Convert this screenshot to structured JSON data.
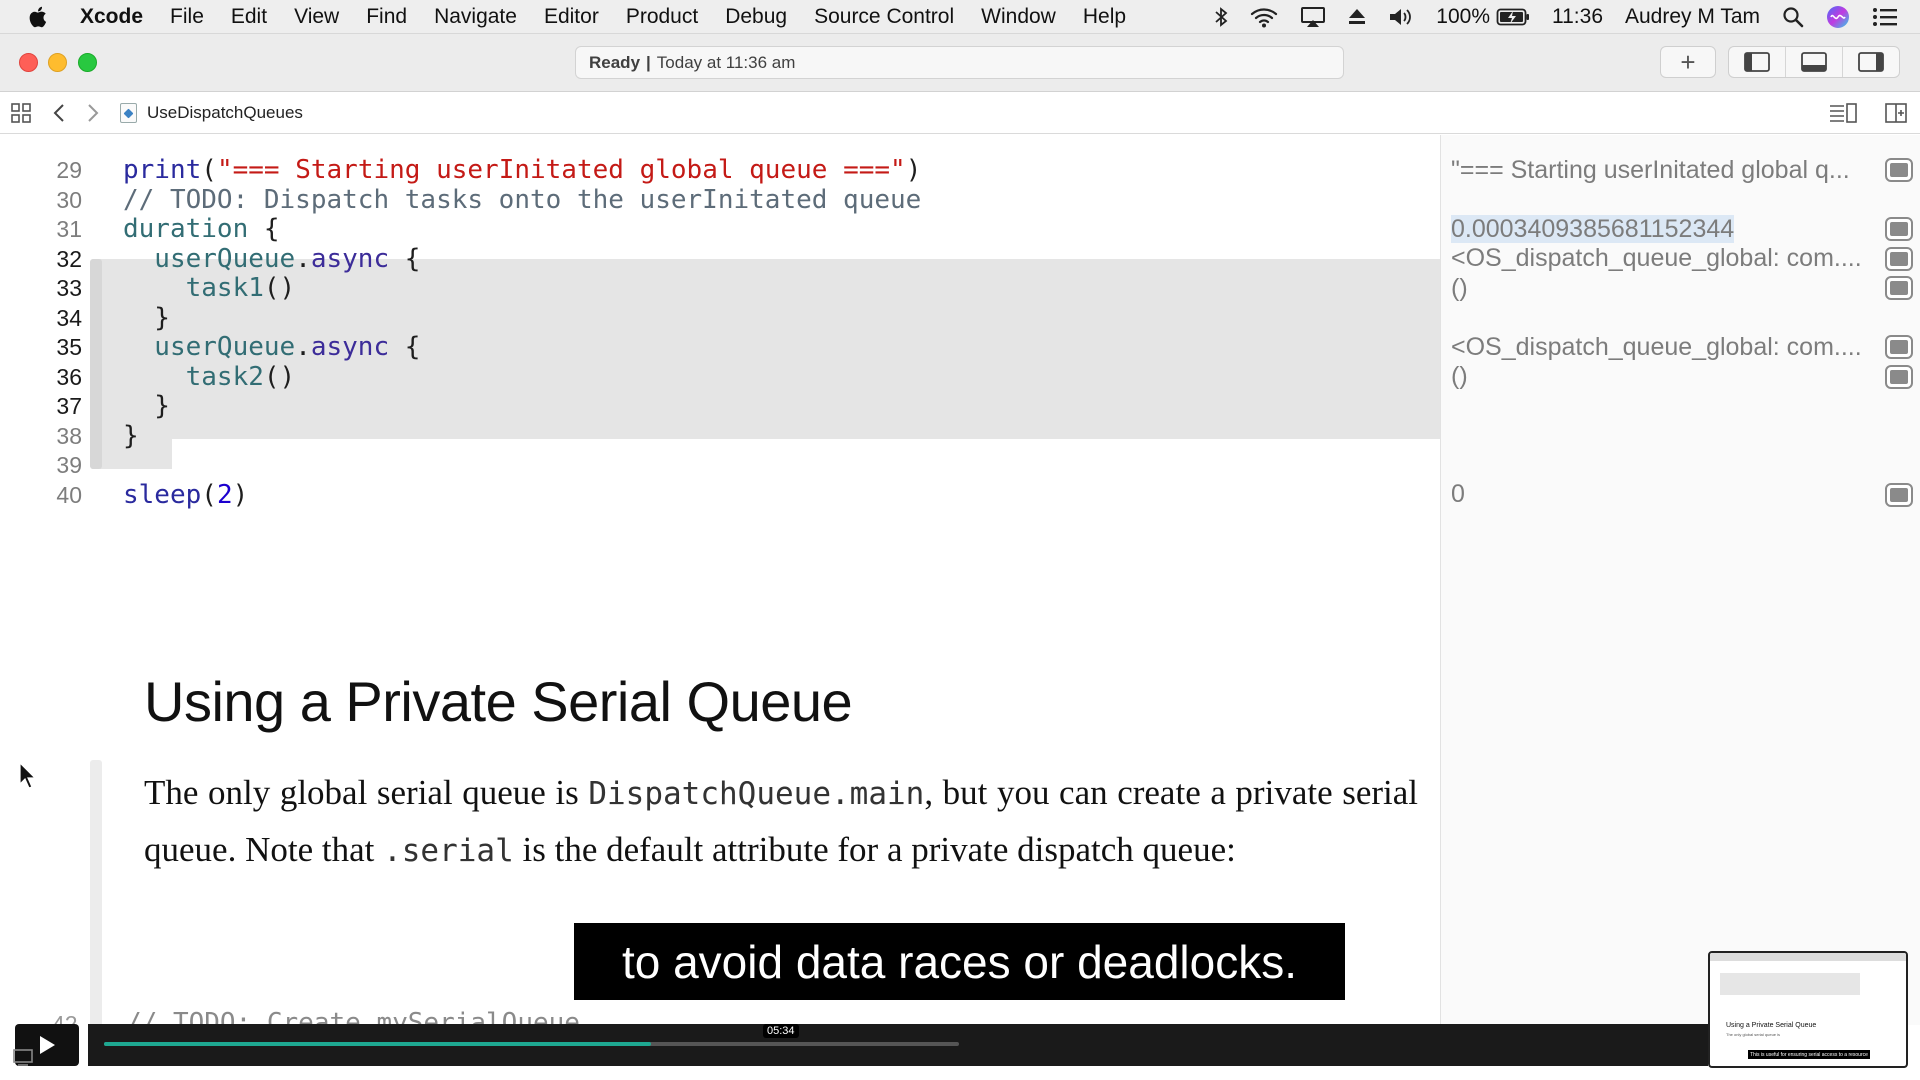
{
  "menubar": {
    "app_name": "Xcode",
    "items": [
      "File",
      "Edit",
      "View",
      "Find",
      "Navigate",
      "Editor",
      "Product",
      "Debug",
      "Source Control",
      "Window",
      "Help"
    ],
    "battery": "100%",
    "time": "11:36",
    "user": "Audrey M Tam"
  },
  "toolbar": {
    "status_label": "Ready",
    "status_detail": "Today at 11:36 am",
    "add_label": "+"
  },
  "jumpbar": {
    "file_name": "UseDispatchQueues"
  },
  "editor": {
    "lines": [
      {
        "num": "29",
        "parts": [
          {
            "t": "print",
            "c": "kw-fn"
          },
          {
            "t": "(",
            "c": ""
          },
          {
            "t": "\"=== Starting userInitated global queue ===\"",
            "c": "kw-str"
          },
          {
            "t": ")",
            "c": ""
          }
        ]
      },
      {
        "num": "30",
        "parts": [
          {
            "t": "// TODO: Dispatch tasks onto the userInitated queue",
            "c": "kw-cm"
          }
        ]
      },
      {
        "num": "31",
        "parts": [
          {
            "t": "duration",
            "c": "kw-id"
          },
          {
            "t": " {",
            "c": ""
          }
        ]
      },
      {
        "num": "32",
        "parts": [
          {
            "t": "  userQueue",
            "c": "kw-id"
          },
          {
            "t": ".",
            "c": ""
          },
          {
            "t": "async",
            "c": "kw-mem"
          },
          {
            "t": " {",
            "c": ""
          }
        ]
      },
      {
        "num": "33",
        "parts": [
          {
            "t": "    task1",
            "c": "kw-id"
          },
          {
            "t": "()",
            "c": ""
          }
        ]
      },
      {
        "num": "34",
        "parts": [
          {
            "t": "  }",
            "c": ""
          }
        ]
      },
      {
        "num": "35",
        "parts": [
          {
            "t": "  userQueue",
            "c": "kw-id"
          },
          {
            "t": ".",
            "c": ""
          },
          {
            "t": "async",
            "c": "kw-mem"
          },
          {
            "t": " {",
            "c": ""
          }
        ]
      },
      {
        "num": "36",
        "parts": [
          {
            "t": "    task2",
            "c": "kw-id"
          },
          {
            "t": "()",
            "c": ""
          }
        ]
      },
      {
        "num": "37",
        "parts": [
          {
            "t": "  }",
            "c": ""
          }
        ]
      },
      {
        "num": "38",
        "parts": [
          {
            "t": "}",
            "c": ""
          }
        ]
      },
      {
        "num": "39",
        "parts": []
      },
      {
        "num": "40",
        "parts": [
          {
            "t": "sleep",
            "c": "kw-fn"
          },
          {
            "t": "(",
            "c": ""
          },
          {
            "t": "2",
            "c": "kw-num"
          },
          {
            "t": ")",
            "c": ""
          }
        ]
      }
    ],
    "doc_title": "Using a Private Serial Queue",
    "doc_para": {
      "p1": "The only global serial queue is ",
      "code1": "DispatchQueue.main",
      "p2": ", but you can create a private serial queue. Note that ",
      "code2": ".serial",
      "p3": " is the default attribute for a private dispatch queue:"
    },
    "ghost_line": "// TODO: Create mySerialQueue",
    "ghost_num": "42"
  },
  "results": [
    {
      "row": 0,
      "text": "\"=== Starting userInitated global q...",
      "selected": false
    },
    {
      "row": 2,
      "text": "0.0003409385681152344",
      "selected": true
    },
    {
      "row": 3,
      "text": "<OS_dispatch_queue_global: com....",
      "selected": false
    },
    {
      "row": 4,
      "text": "()",
      "selected": false
    },
    {
      "row": 6,
      "text": "<OS_dispatch_queue_global: com....",
      "selected": false
    },
    {
      "row": 7,
      "text": "()",
      "selected": false
    },
    {
      "row": 11,
      "text": "0",
      "selected": false
    }
  ],
  "video": {
    "caption": "to avoid data races or deadlocks.",
    "timestamp": "05:34",
    "progress": 0.64,
    "pip_title": "Using a Private Serial Queue",
    "pip_caption": "This is useful for ensuring serial access to a resource"
  }
}
